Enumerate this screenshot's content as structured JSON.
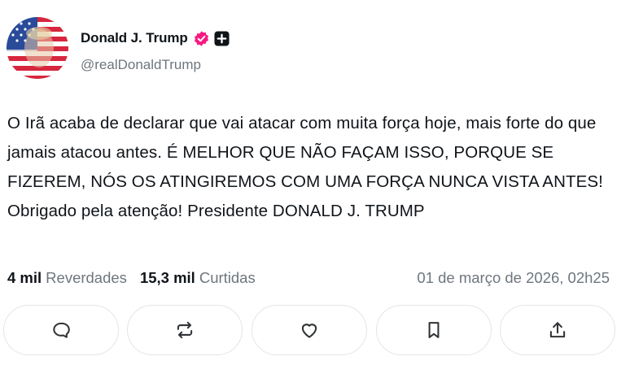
{
  "author": {
    "display_name": "Donald J. Trump",
    "handle": "@realDonaldTrump",
    "avatar_icon": "flag-portrait-avatar",
    "verified_icon": "verified-badge-icon",
    "verified_color": "#f91880",
    "plus_icon": "plus-badge-icon"
  },
  "post": {
    "text": "O Irã acaba de declarar que vai atacar com muita força hoje, mais forte do que jamais atacou antes. É MELHOR QUE NÃO FAÇAM ISSO, PORQUE SE FIZEREM, NÓS OS ATINGIREMOS COM UMA FORÇA NUNCA VISTA ANTES! Obrigado pela atenção! Presidente DONALD J. TRUMP"
  },
  "stats": {
    "reposts_count": "4 mil",
    "reposts_label": "Reverdades",
    "likes_count": "15,3 mil",
    "likes_label": "Curtidas",
    "timestamp": "01 de março de 2026, 02h25"
  },
  "actions": [
    {
      "icon": "comment-icon"
    },
    {
      "icon": "repost-icon"
    },
    {
      "icon": "heart-icon"
    },
    {
      "icon": "bookmark-icon"
    },
    {
      "icon": "share-icon"
    }
  ],
  "colors": {
    "text_primary": "#0f1419",
    "text_secondary": "#6e767d",
    "border": "#e1e5e8"
  }
}
